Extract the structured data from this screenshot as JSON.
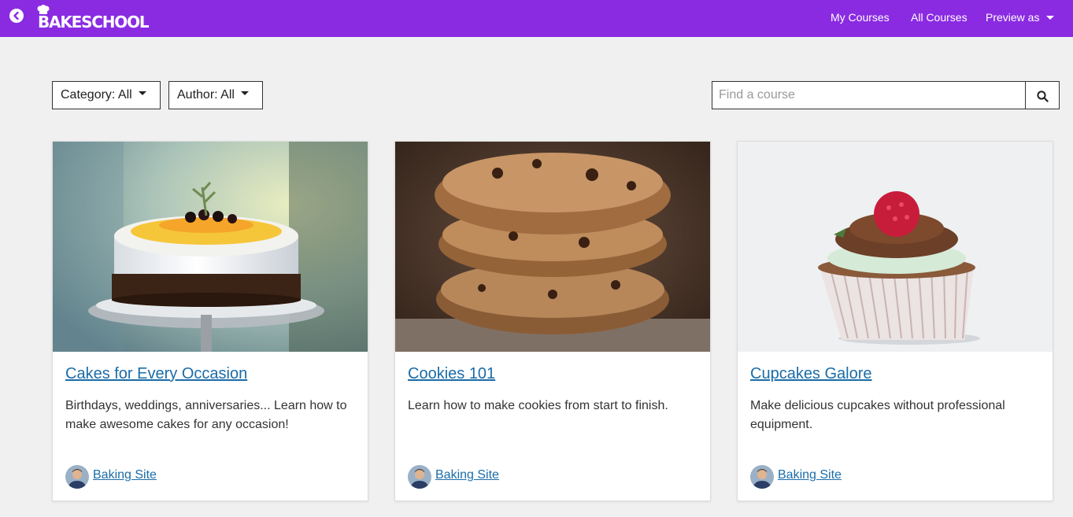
{
  "header": {
    "logo_text": "BAKESCHOOL",
    "nav": {
      "my_courses": "My Courses",
      "all_courses": "All Courses",
      "preview_as": "Preview as"
    },
    "brand_color": "#8a2be2"
  },
  "filters": {
    "category_label": "Category: All",
    "author_label": "Author: All"
  },
  "search": {
    "placeholder": "Find a course",
    "icon": "search-icon"
  },
  "courses": [
    {
      "title": "Cakes for Every Occasion",
      "description": "Birthdays, weddings, anniversaries... Learn how to make awesome cakes for any occasion!",
      "author": "Baking Site",
      "image": "cake-photo"
    },
    {
      "title": "Cookies 101",
      "description": "Learn how to make cookies from start to finish.",
      "author": "Baking Site",
      "image": "cookies-photo"
    },
    {
      "title": "Cupcakes Galore",
      "description": "Make delicious cupcakes without professional equipment.",
      "author": "Baking Site",
      "image": "cupcake-photo"
    }
  ],
  "link_color": "#1a6ca8"
}
